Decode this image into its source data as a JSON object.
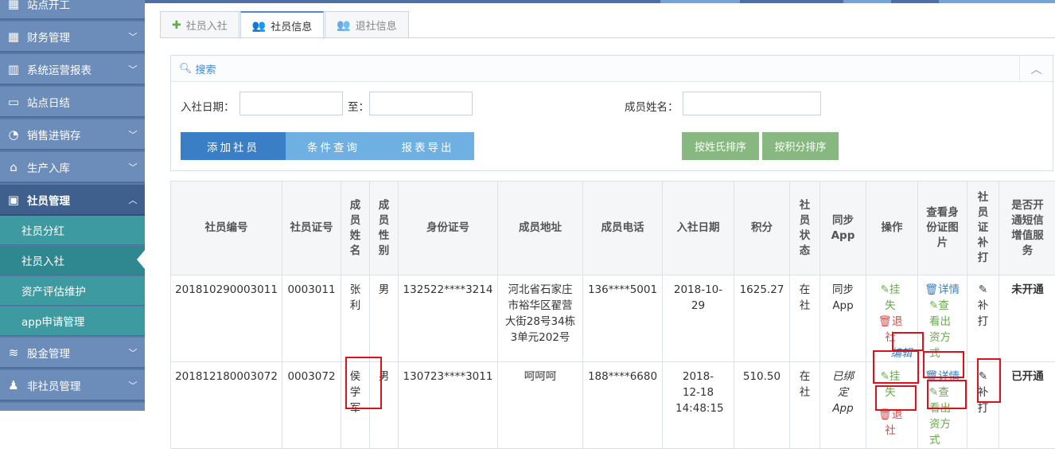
{
  "sidebar": {
    "items": [
      {
        "label": "站点开工",
        "icon": "grid-icon"
      },
      {
        "label": "财务管理",
        "icon": "grid-icon"
      },
      {
        "label": "系统运营报表",
        "icon": "bar-chart-icon"
      },
      {
        "label": "站点日结",
        "icon": "calendar-icon"
      },
      {
        "label": "销售进销存",
        "icon": "pie-chart-icon"
      },
      {
        "label": "生产入库",
        "icon": "bank-icon"
      },
      {
        "label": "社员管理",
        "icon": "image-icon"
      },
      {
        "label": "股金管理",
        "icon": "database-icon"
      },
      {
        "label": "非社员管理",
        "icon": "person-icon"
      }
    ],
    "subitems": [
      "社员分红",
      "社员入社",
      "资产评估维护",
      "app申请管理"
    ]
  },
  "tabs": [
    {
      "label": "社员入社",
      "icon": "plus-icon"
    },
    {
      "label": "社员信息",
      "icon": "users-icon"
    },
    {
      "label": "退社信息",
      "icon": "users-icon"
    }
  ],
  "search": {
    "title": "搜索",
    "join_date_label": "入社日期：",
    "to_label": "至：",
    "name_label": "成员姓名：",
    "join_date_from": "",
    "join_date_to": "",
    "member_name": ""
  },
  "buttons": {
    "add": "添加社员",
    "query": "条件查询",
    "export": "报表导出",
    "sort_name": "按姓氏排序",
    "sort_points": "按积分排序"
  },
  "table": {
    "headers": [
      "社员编号",
      "社员证号",
      "成员姓名",
      "成员性别",
      "身份证号",
      "成员地址",
      "成员电话",
      "入社日期",
      "积分",
      "社员状态",
      "同步App",
      "操作",
      "查看身份证图片",
      "社员证补打",
      "是否开通短信增值服务"
    ],
    "rows": [
      {
        "member_no": "201810290003011",
        "card_no": "0003011",
        "name": "张利",
        "gender": "男",
        "id_no": "132522****3214",
        "address": "河北省石家庄市裕华区翟营大街28号34栋3单元202号",
        "phone": "136****5001",
        "join_date": "2018-10-29",
        "points": "1625.27",
        "status": "在社",
        "sync": "同步App",
        "op_lost": "挂失",
        "op_quit": "退社",
        "op_edit": "编辑",
        "view_detail": "详情",
        "view_contact": "查看出资方式",
        "reprint": "补打",
        "sms": "未开通"
      },
      {
        "member_no": "201812180003072",
        "card_no": "0003072",
        "name": "侯学军",
        "gender": "男",
        "id_no": "130723****3011",
        "address": "呵呵呵",
        "phone": "188****6680",
        "join_date": "2018-12-18 14:48:15",
        "points": "510.50",
        "status": "在社",
        "sync": "已绑定App",
        "op_lost": "挂失",
        "op_quit": "退社",
        "view_detail": "详情",
        "view_contact": "查看出资方式",
        "reprint": "补打",
        "sms": "已开通"
      }
    ]
  },
  "colors": {
    "sidebar": "#6c8cba",
    "sidebar_active": "#3f5f8c",
    "submenu": "#3d9aa0",
    "btn_primary": "#3a7fc5",
    "btn_light": "#6fb0e2",
    "btn_sort": "#87b87f",
    "highlight": "#e0101a"
  }
}
